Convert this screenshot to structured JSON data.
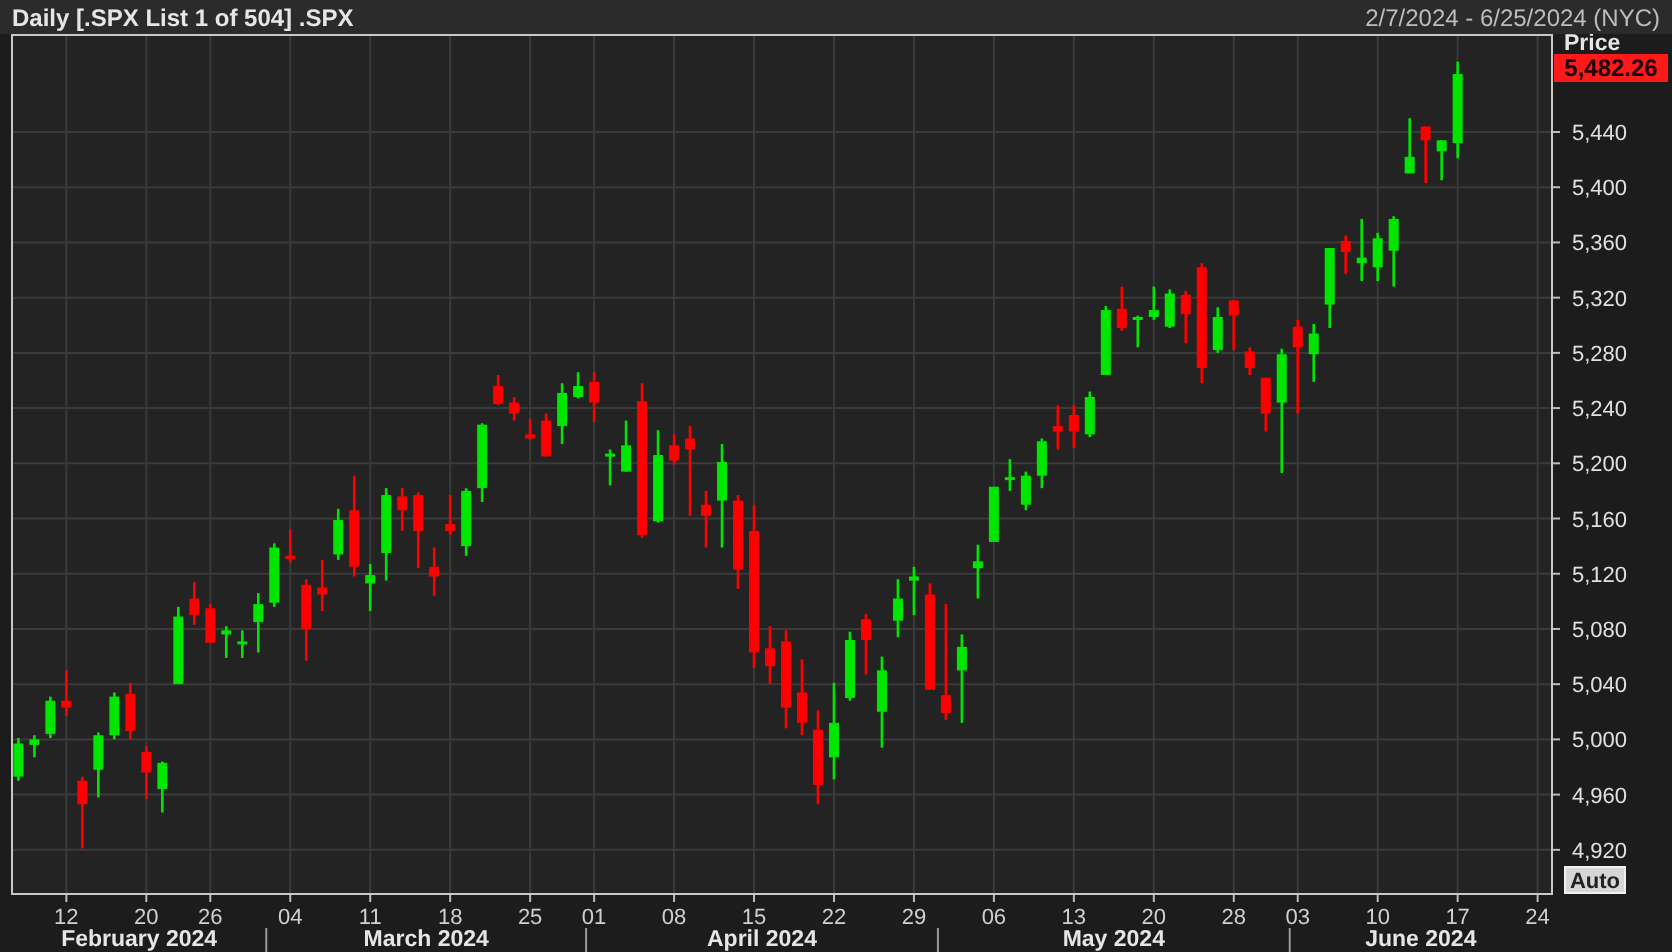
{
  "header": {
    "title": "Daily [.SPX List 1 of 504] .SPX",
    "date_range": "2/7/2024 - 6/25/2024 (NYC)"
  },
  "price_axis": {
    "last_price": "5,482.26",
    "auto_button": "Auto"
  },
  "months": [
    "February 2024",
    "March 2024",
    "April 2024",
    "May 2024",
    "June 2024"
  ],
  "chart_data": {
    "type": "candlestick",
    "ylabel": "Price",
    "grid": true,
    "categories": [
      null,
      null,
      null,
      "12",
      null,
      null,
      null,
      null,
      "20",
      null,
      null,
      null,
      "26",
      null,
      null,
      null,
      null,
      "04",
      null,
      null,
      null,
      null,
      "11",
      null,
      null,
      null,
      null,
      "18",
      null,
      null,
      null,
      null,
      "25",
      null,
      null,
      null,
      "01",
      null,
      null,
      null,
      null,
      "08",
      null,
      null,
      null,
      null,
      "15",
      null,
      null,
      null,
      null,
      "22",
      null,
      null,
      null,
      null,
      "29",
      null,
      null,
      null,
      null,
      "06",
      null,
      null,
      null,
      null,
      "13",
      null,
      null,
      null,
      null,
      "20",
      null,
      null,
      null,
      null,
      "28",
      null,
      null,
      null,
      "03",
      null,
      null,
      null,
      null,
      "10",
      null,
      null,
      null,
      null,
      "17",
      null,
      null,
      null,
      null,
      "24"
    ],
    "ohlc": [
      [
        4973,
        5001,
        4970,
        4997
      ],
      [
        4996,
        5003,
        4987,
        5000
      ],
      [
        5004,
        5031,
        5001,
        5028
      ],
      [
        5028,
        5050,
        5017,
        5023
      ],
      [
        4970,
        4973,
        4921,
        4953
      ],
      [
        4978,
        5005,
        4958,
        5003
      ],
      [
        5003,
        5034,
        5000,
        5031
      ],
      [
        5033,
        5041,
        5000,
        5006
      ],
      [
        4991,
        4995,
        4957,
        4976
      ],
      [
        4964,
        4984,
        4947,
        4983
      ],
      [
        5040,
        5096,
        5040,
        5089
      ],
      [
        5102,
        5114,
        5083,
        5090
      ],
      [
        5095,
        5098,
        5070,
        5070
      ],
      [
        5076,
        5082,
        5059,
        5079
      ],
      [
        5069,
        5079,
        5059,
        5071
      ],
      [
        5085,
        5106,
        5063,
        5098
      ],
      [
        5099,
        5142,
        5096,
        5139
      ],
      [
        5133,
        5152,
        5128,
        5131
      ],
      [
        5112,
        5116,
        5057,
        5080
      ],
      [
        5110,
        5130,
        5093,
        5105
      ],
      [
        5134,
        5167,
        5130,
        5159
      ],
      [
        5166,
        5191,
        5118,
        5125
      ],
      [
        5113,
        5127,
        5093,
        5119
      ],
      [
        5135,
        5182,
        5115,
        5177
      ],
      [
        5176,
        5182,
        5151,
        5166
      ],
      [
        5177,
        5179,
        5124,
        5151
      ],
      [
        5125,
        5139,
        5104,
        5118
      ],
      [
        5156,
        5177,
        5148,
        5151
      ],
      [
        5140,
        5182,
        5133,
        5180
      ],
      [
        5182,
        5229,
        5172,
        5228
      ],
      [
        5256,
        5264,
        5242,
        5243
      ],
      [
        5244,
        5248,
        5231,
        5236
      ],
      [
        5221,
        5232,
        5217,
        5218
      ],
      [
        5231,
        5236,
        5205,
        5205
      ],
      [
        5227,
        5258,
        5214,
        5251
      ],
      [
        5248,
        5266,
        5247,
        5256
      ],
      [
        5259,
        5266,
        5230,
        5244
      ],
      [
        5205,
        5210,
        5184,
        5207
      ],
      [
        5194,
        5231,
        5194,
        5213
      ],
      [
        5245,
        5258,
        5146,
        5148
      ],
      [
        5158,
        5224,
        5157,
        5206
      ],
      [
        5213,
        5221,
        5199,
        5202
      ],
      [
        5218,
        5227,
        5162,
        5210
      ],
      [
        5170,
        5180,
        5139,
        5162
      ],
      [
        5173,
        5214,
        5139,
        5201
      ],
      [
        5173,
        5177,
        5109,
        5123
      ],
      [
        5151,
        5170,
        5052,
        5063
      ],
      [
        5066,
        5082,
        5040,
        5053
      ],
      [
        5071,
        5079,
        5008,
        5023
      ],
      [
        5034,
        5058,
        5003,
        5012
      ],
      [
        5007,
        5021,
        4953,
        4967
      ],
      [
        4987,
        5041,
        4971,
        5012
      ],
      [
        5030,
        5078,
        5028,
        5072
      ],
      [
        5087,
        5091,
        5047,
        5072
      ],
      [
        5020,
        5060,
        4994,
        5050
      ],
      [
        5086,
        5116,
        5074,
        5102
      ],
      [
        5115,
        5125,
        5090,
        5118
      ],
      [
        5105,
        5113,
        5036,
        5036
      ],
      [
        5032,
        5098,
        5014,
        5019
      ],
      [
        5050,
        5076,
        5012,
        5067
      ],
      [
        5124,
        5141,
        5102,
        5129
      ],
      [
        5143,
        5183,
        5143,
        5183
      ],
      [
        5188,
        5203,
        5180,
        5190
      ],
      [
        5170,
        5194,
        5166,
        5191
      ],
      [
        5191,
        5218,
        5182,
        5216
      ],
      [
        5227,
        5242,
        5210,
        5223
      ],
      [
        5235,
        5242,
        5211,
        5223
      ],
      [
        5221,
        5252,
        5219,
        5248
      ],
      [
        5264,
        5314,
        5264,
        5311
      ],
      [
        5312,
        5328,
        5296,
        5298
      ],
      [
        5304,
        5307,
        5284,
        5306
      ],
      [
        5306,
        5328,
        5304,
        5311
      ],
      [
        5299,
        5326,
        5298,
        5323
      ],
      [
        5322,
        5325,
        5287,
        5308
      ],
      [
        5342,
        5345,
        5258,
        5269
      ],
      [
        5282,
        5313,
        5280,
        5306
      ],
      [
        5318,
        5318,
        5282,
        5307
      ],
      [
        5281,
        5284,
        5264,
        5269
      ],
      [
        5262,
        5262,
        5223,
        5236
      ],
      [
        5244,
        5283,
        5193,
        5279
      ],
      [
        5299,
        5304,
        5236,
        5284
      ],
      [
        5279,
        5301,
        5259,
        5294
      ],
      [
        5315,
        5356,
        5298,
        5356
      ],
      [
        5361,
        5365,
        5337,
        5353
      ],
      [
        5345,
        5377,
        5332,
        5349
      ],
      [
        5342,
        5367,
        5332,
        5363
      ],
      [
        5354,
        5379,
        5328,
        5377
      ],
      [
        5410,
        5450,
        5410,
        5422
      ],
      [
        5444,
        5444,
        5403,
        5434
      ],
      [
        5426,
        5434,
        5405,
        5434
      ],
      [
        5432,
        5491,
        5421,
        5482
      ],
      null,
      null,
      null,
      null,
      null
    ],
    "ylim": [
      4888,
      5511
    ],
    "yticks": [
      {
        "value": 4920,
        "label": "4,920"
      },
      {
        "value": 4960,
        "label": "4,960"
      },
      {
        "value": 5000,
        "label": "5,000"
      },
      {
        "value": 5040,
        "label": "5,040"
      },
      {
        "value": 5080,
        "label": "5,080"
      },
      {
        "value": 5120,
        "label": "5,120"
      },
      {
        "value": 5160,
        "label": "5,160"
      },
      {
        "value": 5200,
        "label": "5,200"
      },
      {
        "value": 5240,
        "label": "5,240"
      },
      {
        "value": 5280,
        "label": "5,280"
      },
      {
        "value": 5320,
        "label": "5,320"
      },
      {
        "value": 5360,
        "label": "5,360"
      },
      {
        "value": 5400,
        "label": "5,400"
      },
      {
        "value": 5440,
        "label": "5,440"
      }
    ]
  }
}
